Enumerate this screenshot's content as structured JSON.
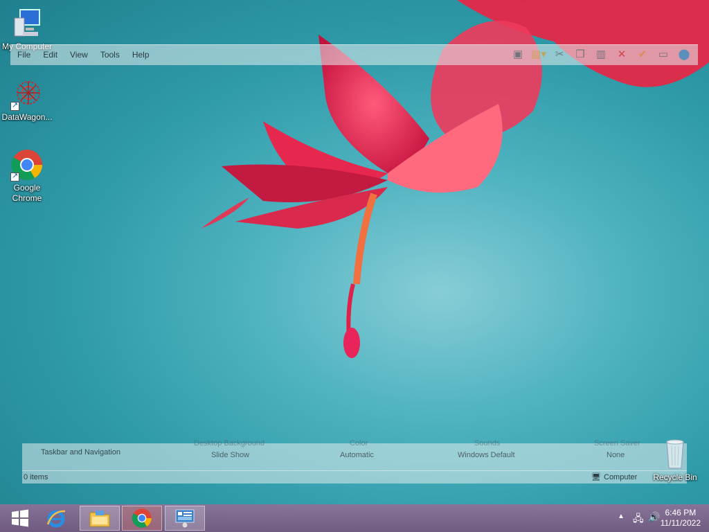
{
  "desktop": {
    "icons": [
      {
        "label": "My Computer"
      },
      {
        "label": "DataWagon..."
      },
      {
        "label": "Google Chrome"
      },
      {
        "label": "Recycle Bin"
      }
    ]
  },
  "ghost_window": {
    "menu": [
      "File",
      "Edit",
      "View",
      "Tools",
      "Help"
    ],
    "toolbar_icons": [
      "layout-icon",
      "folder-dropdown-icon",
      "cut-icon",
      "copy-icon",
      "paste-icon",
      "delete-icon",
      "check-icon",
      "properties-icon",
      "globe-icon"
    ],
    "personalize_row": {
      "taskbar_label": "Taskbar and Navigation",
      "desktop_background_label": "Desktop Background",
      "desktop_background_value": "Slide Show",
      "color_label": "Color",
      "color_value": "Automatic",
      "sounds_label": "Sounds",
      "sounds_value": "Windows Default",
      "screensaver_label": "Screen Saver",
      "screensaver_value": "None"
    },
    "status": {
      "items": "0 items",
      "location": "Computer"
    }
  },
  "taskbar": {
    "apps": [
      "start-icon",
      "internet-explorer-icon",
      "file-explorer-icon",
      "chrome-icon",
      "control-panel-icon"
    ],
    "clock": {
      "time": "6:46 PM",
      "date": "11/11/2022"
    }
  }
}
